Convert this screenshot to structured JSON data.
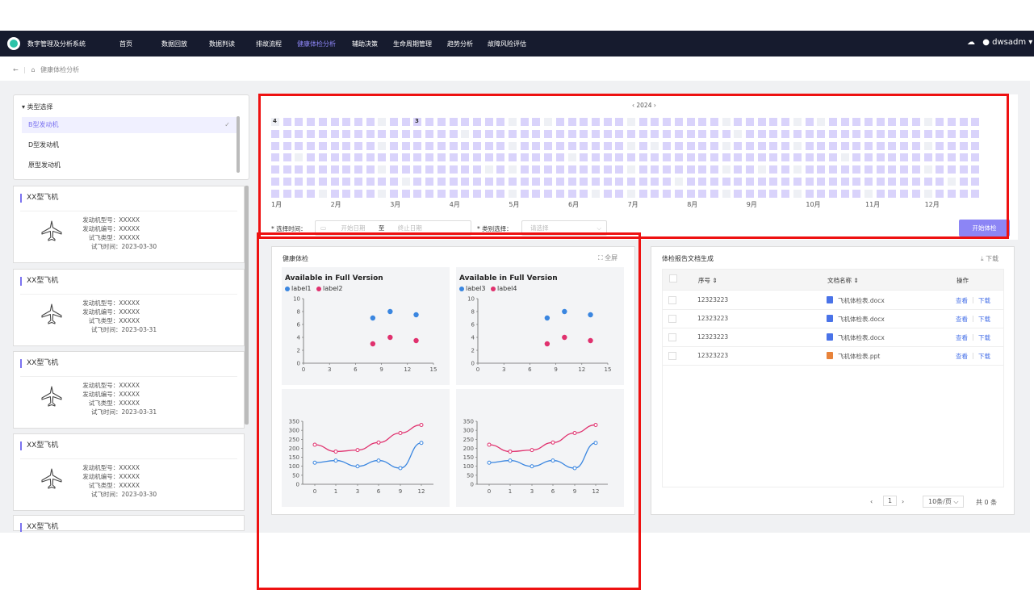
{
  "app": {
    "title": "数字管理及分析系统",
    "user": "dwsadm"
  },
  "nav": [
    "首页",
    "数据回放",
    "数据判读",
    "排故流程",
    "健康体检分析",
    "辅助决策",
    "生命周期管理",
    "趋势分析",
    "故障风险评估"
  ],
  "breadcrumb": "健康体检分析",
  "type_panel": {
    "title": "类型选择",
    "items": [
      "B型发动机",
      "D型发动机",
      "原型发动机"
    ],
    "selected": 0
  },
  "aircraft_cards": [
    {
      "title": "XX型飞机",
      "engine_model": "发动机型号：XXXXX",
      "engine_no": "发动机编号：XXXXX",
      "test_type": "试飞类型：XXXXX",
      "test_time": "试飞时间：2023-03-30"
    },
    {
      "title": "XX型飞机",
      "engine_model": "发动机型号：XXXXX",
      "engine_no": "发动机编号：XXXXX",
      "test_type": "试飞类型：XXXXX",
      "test_time": "试飞时间：2023-03-31"
    },
    {
      "title": "XX型飞机",
      "engine_model": "发动机型号：XXXXX",
      "engine_no": "发动机编号：XXXXX",
      "test_type": "试飞类型：XXXXX",
      "test_time": "试飞时间：2023-03-31"
    },
    {
      "title": "XX型飞机",
      "engine_model": "发动机型号：XXXXX",
      "engine_no": "发动机编号：XXXXX",
      "test_type": "试飞类型：XXXXX",
      "test_time": "试飞时间：2023-03-30"
    },
    {
      "title": "XX型飞机"
    }
  ],
  "calendar": {
    "year_label": "‹ 2024 ›",
    "months": [
      "1月",
      "2月",
      "3月",
      "4月",
      "5月",
      "6月",
      "7月",
      "8月",
      "9月",
      "10月",
      "11月",
      "12月"
    ],
    "badges": [
      "4",
      "3"
    ]
  },
  "filters": {
    "time_label": "* 选择时间：",
    "start_placeholder": "开始日期",
    "to": "至",
    "end_placeholder": "终止日期",
    "category_label": "* 类别选择：",
    "category_placeholder": "请选择",
    "start_button": "开始体检"
  },
  "health": {
    "title": "健康体检",
    "fullscreen": "⛶ 全屏"
  },
  "chart_data": [
    {
      "type": "scatter",
      "title": "Available in Full Version",
      "xlim": [
        0,
        15
      ],
      "ylim": [
        0,
        10
      ],
      "xticks": [
        "0",
        "3",
        "6",
        "9",
        "12",
        "15"
      ],
      "yticks": [
        "0",
        "2",
        "4",
        "6",
        "8",
        "10"
      ],
      "series": [
        {
          "name": "label1",
          "color": "#3a86e0",
          "points": [
            [
              8,
              7
            ],
            [
              10,
              8
            ],
            [
              13,
              7.5
            ]
          ]
        },
        {
          "name": "label2",
          "color": "#e0316e",
          "points": [
            [
              8,
              3
            ],
            [
              10,
              4
            ],
            [
              13,
              3.5
            ]
          ]
        }
      ]
    },
    {
      "type": "scatter",
      "title": "Available in Full Version",
      "xlim": [
        0,
        15
      ],
      "ylim": [
        0,
        10
      ],
      "xticks": [
        "0",
        "3",
        "6",
        "9",
        "12",
        "15"
      ],
      "yticks": [
        "0",
        "2",
        "4",
        "6",
        "8",
        "10"
      ],
      "series": [
        {
          "name": "label3",
          "color": "#3a86e0",
          "points": [
            [
              8,
              7
            ],
            [
              10,
              8
            ],
            [
              13,
              7.5
            ]
          ]
        },
        {
          "name": "label4",
          "color": "#e0316e",
          "points": [
            [
              8,
              3
            ],
            [
              10,
              4
            ],
            [
              13,
              3.5
            ]
          ]
        }
      ]
    },
    {
      "type": "line",
      "categories": [
        "0",
        "1",
        "3",
        "6",
        "9",
        "12"
      ],
      "ylim": [
        0,
        350
      ],
      "yticks": [
        "0",
        "50",
        "100",
        "150",
        "200",
        "250",
        "300",
        "350"
      ],
      "series": [
        {
          "color": "#e0316e",
          "values": [
            220,
            182,
            190,
            232,
            285,
            330
          ]
        },
        {
          "color": "#3a86e0",
          "values": [
            120,
            132,
            100,
            132,
            90,
            230
          ]
        }
      ]
    },
    {
      "type": "line",
      "categories": [
        "0",
        "1",
        "3",
        "6",
        "9",
        "12"
      ],
      "ylim": [
        0,
        350
      ],
      "yticks": [
        "0",
        "50",
        "100",
        "150",
        "200",
        "250",
        "300",
        "350"
      ],
      "series": [
        {
          "color": "#e0316e",
          "values": [
            220,
            182,
            190,
            232,
            285,
            330
          ]
        },
        {
          "color": "#3a86e0",
          "values": [
            120,
            132,
            100,
            132,
            90,
            230
          ]
        }
      ]
    }
  ],
  "report": {
    "title": "体检报告文档生成",
    "download": "⤓ 下载",
    "columns": [
      "序号 ⇕",
      "文档名称 ⇕",
      "操作"
    ],
    "rows": [
      {
        "no": "12323223",
        "name": "飞机体检表.docx",
        "view": "查看",
        "dl": "下载"
      },
      {
        "no": "12323223",
        "name": "飞机体检表.docx",
        "view": "查看",
        "dl": "下载"
      },
      {
        "no": "12323223",
        "name": "飞机体检表.docx",
        "view": "查看",
        "dl": "下载"
      },
      {
        "no": "12323223",
        "name": "飞机体检表.ppt",
        "view": "查看",
        "dl": "下载"
      }
    ],
    "pagination": {
      "prev": "‹",
      "page": "1",
      "next": "›",
      "size": "10条/页 ⌵",
      "total": "共 0 条"
    }
  }
}
